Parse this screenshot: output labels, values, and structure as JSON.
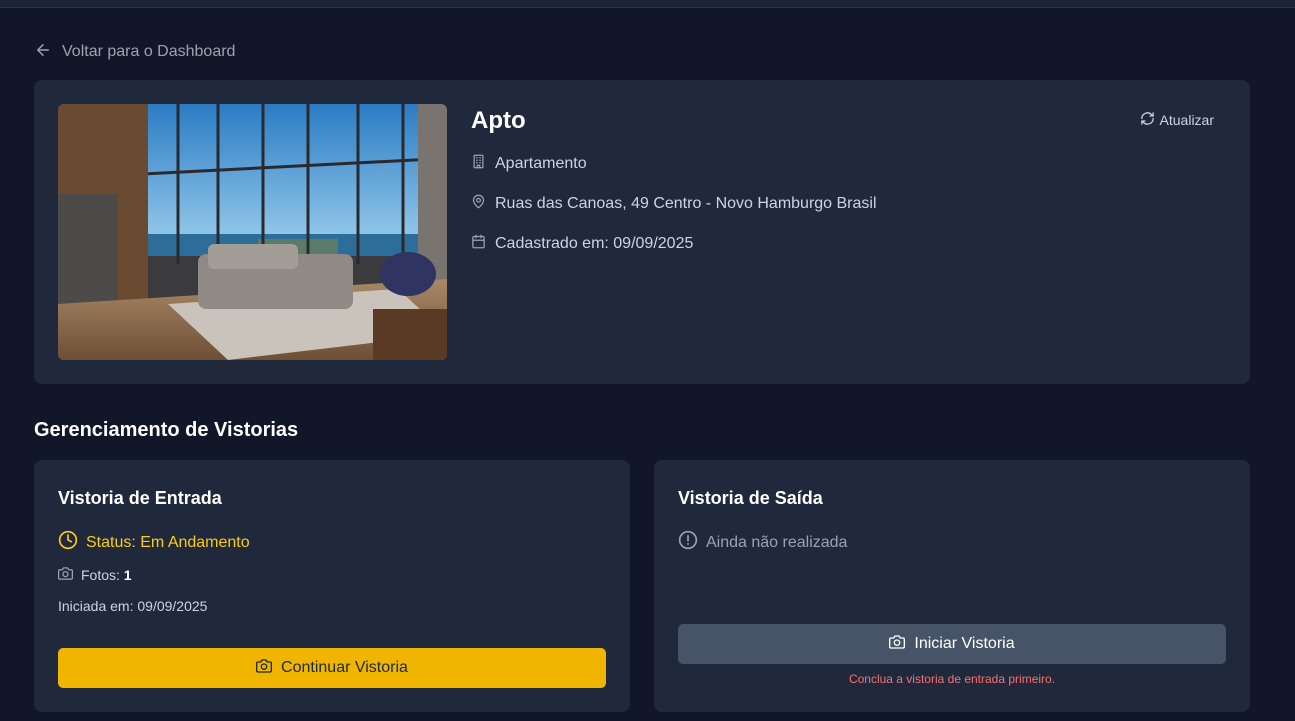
{
  "nav": {
    "back_label": "Voltar para o Dashboard"
  },
  "property": {
    "name": "Apto",
    "refresh_label": "Atualizar",
    "type": "Apartamento",
    "address": "Ruas das Canoas, 49 Centro - Novo Hamburgo Brasil",
    "registered": "Cadastrado em: 09/09/2025"
  },
  "section_title": "Gerenciamento de Vistorias",
  "entry": {
    "title": "Vistoria de Entrada",
    "status": "Status: Em Andamento",
    "photos_label": "Fotos:",
    "photos_count": "1",
    "started": "Iniciada em: 09/09/2025",
    "button": "Continuar Vistoria"
  },
  "exit": {
    "title": "Vistoria de Saída",
    "status": "Ainda não realizada",
    "button": "Iniciar Vistoria",
    "warning": "Conclua a vistoria de entrada primeiro."
  },
  "colors": {
    "background": "#111729",
    "card": "#1f293b",
    "accent_yellow": "#f0b500",
    "status_yellow": "#facc15",
    "error_red": "#f87171",
    "disabled_button": "#475467"
  },
  "icons": {
    "back": "arrow-left-icon",
    "refresh": "refresh-icon",
    "type": "building-icon",
    "address": "map-pin-icon",
    "date": "calendar-icon",
    "status_progress": "clock-icon",
    "status_pending": "alert-circle-icon",
    "camera": "camera-icon"
  }
}
